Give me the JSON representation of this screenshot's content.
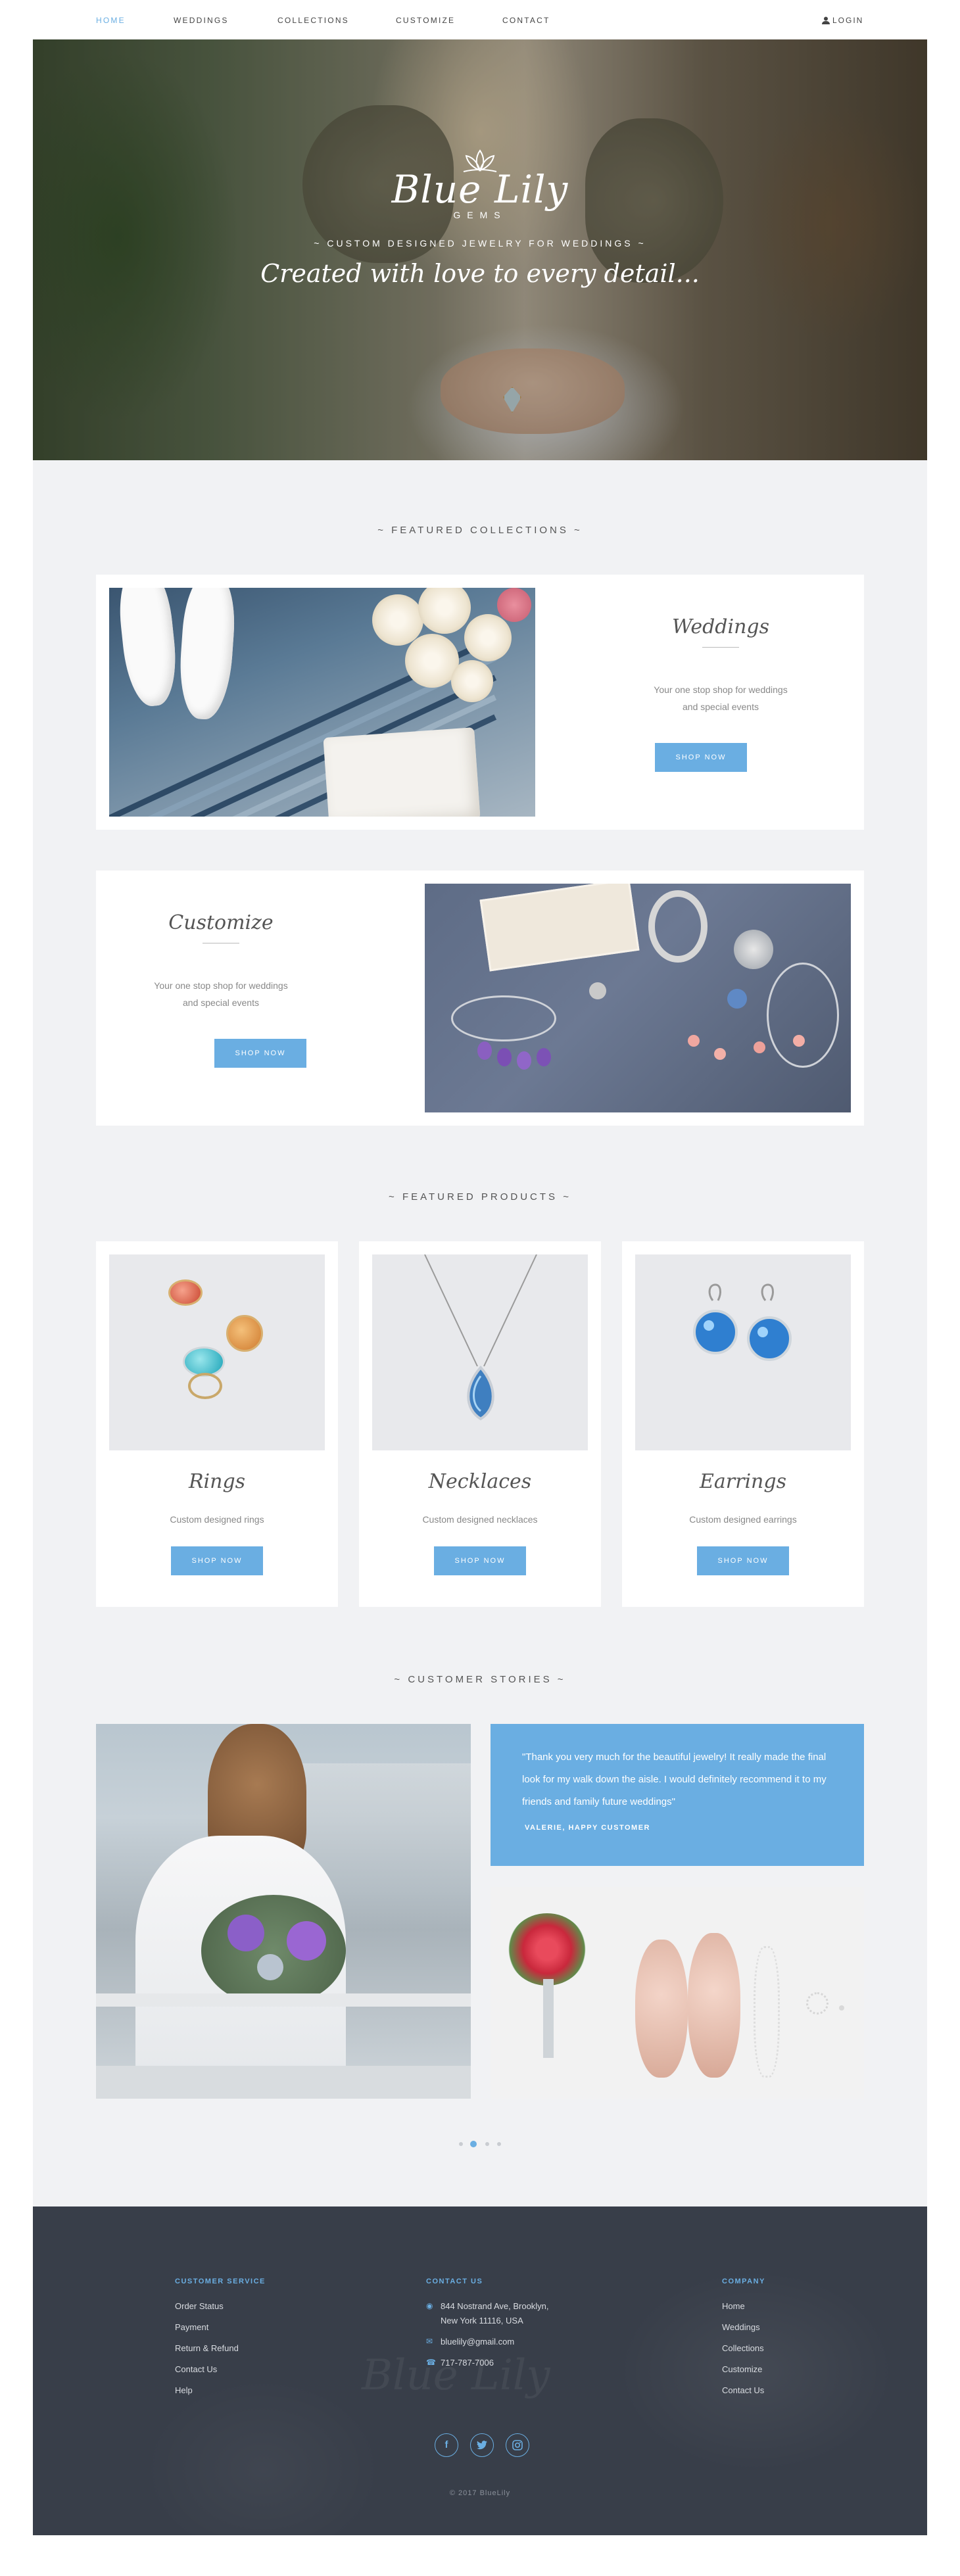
{
  "nav": {
    "items": [
      "HOME",
      "WEDDINGS",
      "COLLECTIONS",
      "CUSTOMIZE",
      "CONTACT"
    ],
    "active": "HOME",
    "login": "LOGIN"
  },
  "hero": {
    "logo_script": "Blue Lily",
    "logo_sub": "GEMS",
    "tagline": "~ Custom designed jewelry for weddings ~",
    "script": "Created with love to every detail..."
  },
  "featured_collections": {
    "title": "~ Featured Collections ~",
    "items": [
      {
        "title": "Weddings",
        "desc_line1": "Your one stop shop for weddings",
        "desc_line2": "and special events",
        "button": "SHOP NOW"
      },
      {
        "title": "Customize",
        "desc_line1": "Your one stop shop for weddings",
        "desc_line2": "and special events",
        "button": "SHOP NOW"
      }
    ]
  },
  "featured_products": {
    "title": "~ Featured Products ~",
    "items": [
      {
        "title": "Rings",
        "desc": "Custom designed rings",
        "button": "SHOP NOW"
      },
      {
        "title": "Necklaces",
        "desc": "Custom designed necklaces",
        "button": "SHOP NOW"
      },
      {
        "title": "Earrings",
        "desc": "Custom designed earrings",
        "button": "SHOP NOW"
      }
    ]
  },
  "stories": {
    "title": "~ Customer Stories ~",
    "quote": "\"Thank you very much for the beautiful jewelry! It really made the final look for my walk down the aisle. I would definitely recommend it to my friends and family future weddings\"",
    "author": "VALERIE, HAPPY CUSTOMER"
  },
  "footer": {
    "customer_service": {
      "heading": "CUSTOMER SERVICE",
      "links": [
        "Order Status",
        "Payment",
        "Return & Refund",
        "Contact Us",
        "Help"
      ]
    },
    "contact": {
      "heading": "CONTACT US",
      "address_line1": "844 Nostrand Ave, Brooklyn,",
      "address_line2": "New York 11116, USA",
      "email": "bluelily@gmail.com",
      "phone": "717-787-7006"
    },
    "company": {
      "heading": "COMPANY",
      "links": [
        "Home",
        "Weddings",
        "Collections",
        "Customize",
        "Contact Us"
      ]
    },
    "social": [
      "f",
      "t",
      "ig"
    ],
    "copyright": "© 2017 BlueLily"
  },
  "colors": {
    "accent": "#6aaee2",
    "background": "#f1f2f4",
    "footer": "#383e49"
  }
}
